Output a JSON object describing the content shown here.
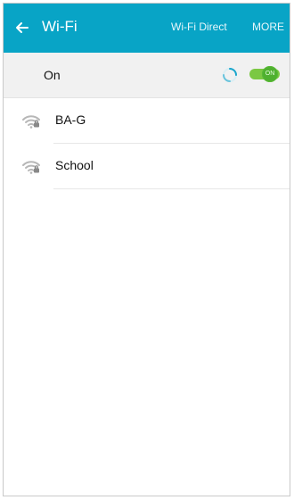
{
  "app_bar": {
    "title": "Wi-Fi",
    "actions": {
      "wifi_direct": "Wi-Fi Direct",
      "more": "MORE"
    },
    "color": "#08a4c6"
  },
  "wifi_toggle": {
    "label": "On",
    "switch_text": "ON",
    "enabled": true,
    "scanning": true,
    "accent": "#4fb030"
  },
  "networks": [
    {
      "ssid": "BA-G",
      "icon": "wifi-lock-icon"
    },
    {
      "ssid": "School",
      "icon": "wifi-lock-icon"
    }
  ]
}
